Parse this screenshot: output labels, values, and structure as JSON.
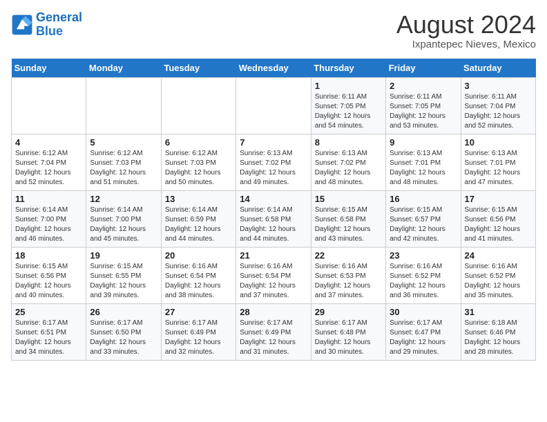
{
  "header": {
    "logo_line1": "General",
    "logo_line2": "Blue",
    "month": "August 2024",
    "location": "Ixpantepec Nieves, Mexico"
  },
  "days_of_week": [
    "Sunday",
    "Monday",
    "Tuesday",
    "Wednesday",
    "Thursday",
    "Friday",
    "Saturday"
  ],
  "weeks": [
    [
      {
        "day": "",
        "info": ""
      },
      {
        "day": "",
        "info": ""
      },
      {
        "day": "",
        "info": ""
      },
      {
        "day": "",
        "info": ""
      },
      {
        "day": "1",
        "info": "Sunrise: 6:11 AM\nSunset: 7:05 PM\nDaylight: 12 hours\nand 54 minutes."
      },
      {
        "day": "2",
        "info": "Sunrise: 6:11 AM\nSunset: 7:05 PM\nDaylight: 12 hours\nand 53 minutes."
      },
      {
        "day": "3",
        "info": "Sunrise: 6:11 AM\nSunset: 7:04 PM\nDaylight: 12 hours\nand 52 minutes."
      }
    ],
    [
      {
        "day": "4",
        "info": "Sunrise: 6:12 AM\nSunset: 7:04 PM\nDaylight: 12 hours\nand 52 minutes."
      },
      {
        "day": "5",
        "info": "Sunrise: 6:12 AM\nSunset: 7:03 PM\nDaylight: 12 hours\nand 51 minutes."
      },
      {
        "day": "6",
        "info": "Sunrise: 6:12 AM\nSunset: 7:03 PM\nDaylight: 12 hours\nand 50 minutes."
      },
      {
        "day": "7",
        "info": "Sunrise: 6:13 AM\nSunset: 7:02 PM\nDaylight: 12 hours\nand 49 minutes."
      },
      {
        "day": "8",
        "info": "Sunrise: 6:13 AM\nSunset: 7:02 PM\nDaylight: 12 hours\nand 48 minutes."
      },
      {
        "day": "9",
        "info": "Sunrise: 6:13 AM\nSunset: 7:01 PM\nDaylight: 12 hours\nand 48 minutes."
      },
      {
        "day": "10",
        "info": "Sunrise: 6:13 AM\nSunset: 7:01 PM\nDaylight: 12 hours\nand 47 minutes."
      }
    ],
    [
      {
        "day": "11",
        "info": "Sunrise: 6:14 AM\nSunset: 7:00 PM\nDaylight: 12 hours\nand 46 minutes."
      },
      {
        "day": "12",
        "info": "Sunrise: 6:14 AM\nSunset: 7:00 PM\nDaylight: 12 hours\nand 45 minutes."
      },
      {
        "day": "13",
        "info": "Sunrise: 6:14 AM\nSunset: 6:59 PM\nDaylight: 12 hours\nand 44 minutes."
      },
      {
        "day": "14",
        "info": "Sunrise: 6:14 AM\nSunset: 6:58 PM\nDaylight: 12 hours\nand 44 minutes."
      },
      {
        "day": "15",
        "info": "Sunrise: 6:15 AM\nSunset: 6:58 PM\nDaylight: 12 hours\nand 43 minutes."
      },
      {
        "day": "16",
        "info": "Sunrise: 6:15 AM\nSunset: 6:57 PM\nDaylight: 12 hours\nand 42 minutes."
      },
      {
        "day": "17",
        "info": "Sunrise: 6:15 AM\nSunset: 6:56 PM\nDaylight: 12 hours\nand 41 minutes."
      }
    ],
    [
      {
        "day": "18",
        "info": "Sunrise: 6:15 AM\nSunset: 6:56 PM\nDaylight: 12 hours\nand 40 minutes."
      },
      {
        "day": "19",
        "info": "Sunrise: 6:15 AM\nSunset: 6:55 PM\nDaylight: 12 hours\nand 39 minutes."
      },
      {
        "day": "20",
        "info": "Sunrise: 6:16 AM\nSunset: 6:54 PM\nDaylight: 12 hours\nand 38 minutes."
      },
      {
        "day": "21",
        "info": "Sunrise: 6:16 AM\nSunset: 6:54 PM\nDaylight: 12 hours\nand 37 minutes."
      },
      {
        "day": "22",
        "info": "Sunrise: 6:16 AM\nSunset: 6:53 PM\nDaylight: 12 hours\nand 37 minutes."
      },
      {
        "day": "23",
        "info": "Sunrise: 6:16 AM\nSunset: 6:52 PM\nDaylight: 12 hours\nand 36 minutes."
      },
      {
        "day": "24",
        "info": "Sunrise: 6:16 AM\nSunset: 6:52 PM\nDaylight: 12 hours\nand 35 minutes."
      }
    ],
    [
      {
        "day": "25",
        "info": "Sunrise: 6:17 AM\nSunset: 6:51 PM\nDaylight: 12 hours\nand 34 minutes."
      },
      {
        "day": "26",
        "info": "Sunrise: 6:17 AM\nSunset: 6:50 PM\nDaylight: 12 hours\nand 33 minutes."
      },
      {
        "day": "27",
        "info": "Sunrise: 6:17 AM\nSunset: 6:49 PM\nDaylight: 12 hours\nand 32 minutes."
      },
      {
        "day": "28",
        "info": "Sunrise: 6:17 AM\nSunset: 6:49 PM\nDaylight: 12 hours\nand 31 minutes."
      },
      {
        "day": "29",
        "info": "Sunrise: 6:17 AM\nSunset: 6:48 PM\nDaylight: 12 hours\nand 30 minutes."
      },
      {
        "day": "30",
        "info": "Sunrise: 6:17 AM\nSunset: 6:47 PM\nDaylight: 12 hours\nand 29 minutes."
      },
      {
        "day": "31",
        "info": "Sunrise: 6:18 AM\nSunset: 6:46 PM\nDaylight: 12 hours\nand 28 minutes."
      }
    ]
  ]
}
